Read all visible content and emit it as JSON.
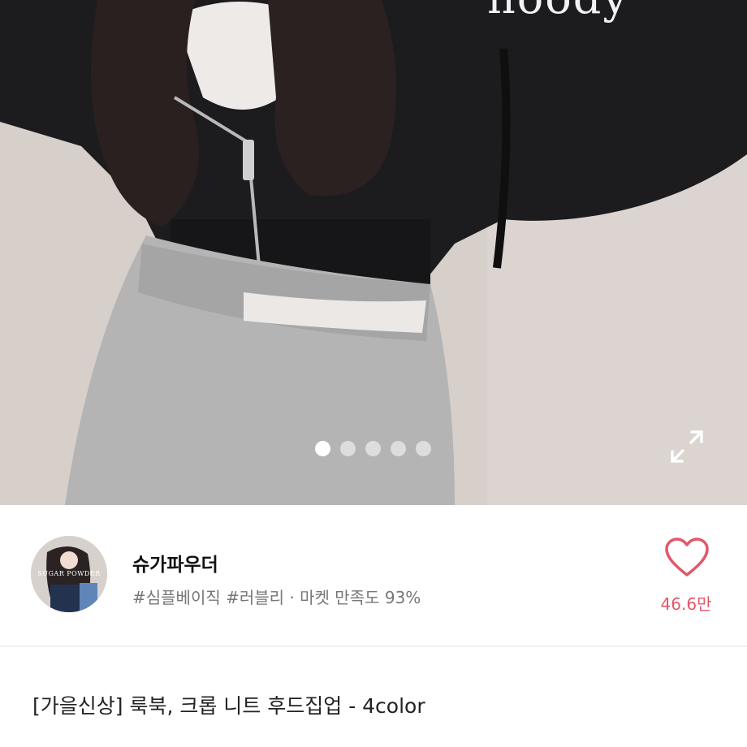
{
  "hero": {
    "overlay_text": "hoody",
    "carousel": {
      "total": 5,
      "active_index": 0
    },
    "expand_icon": "expand-icon"
  },
  "seller": {
    "name": "슈가파우더",
    "meta": "#심플베이직 #러블리 · 마켓 만족도 93%",
    "avatar_text": "SUGAR POWDER"
  },
  "like": {
    "icon": "heart-outline-icon",
    "count": "46.6만",
    "color": "#e2576a"
  },
  "product": {
    "title": "[가을신상] 룩북, 크롭 니트 후드집업 - 4color"
  }
}
